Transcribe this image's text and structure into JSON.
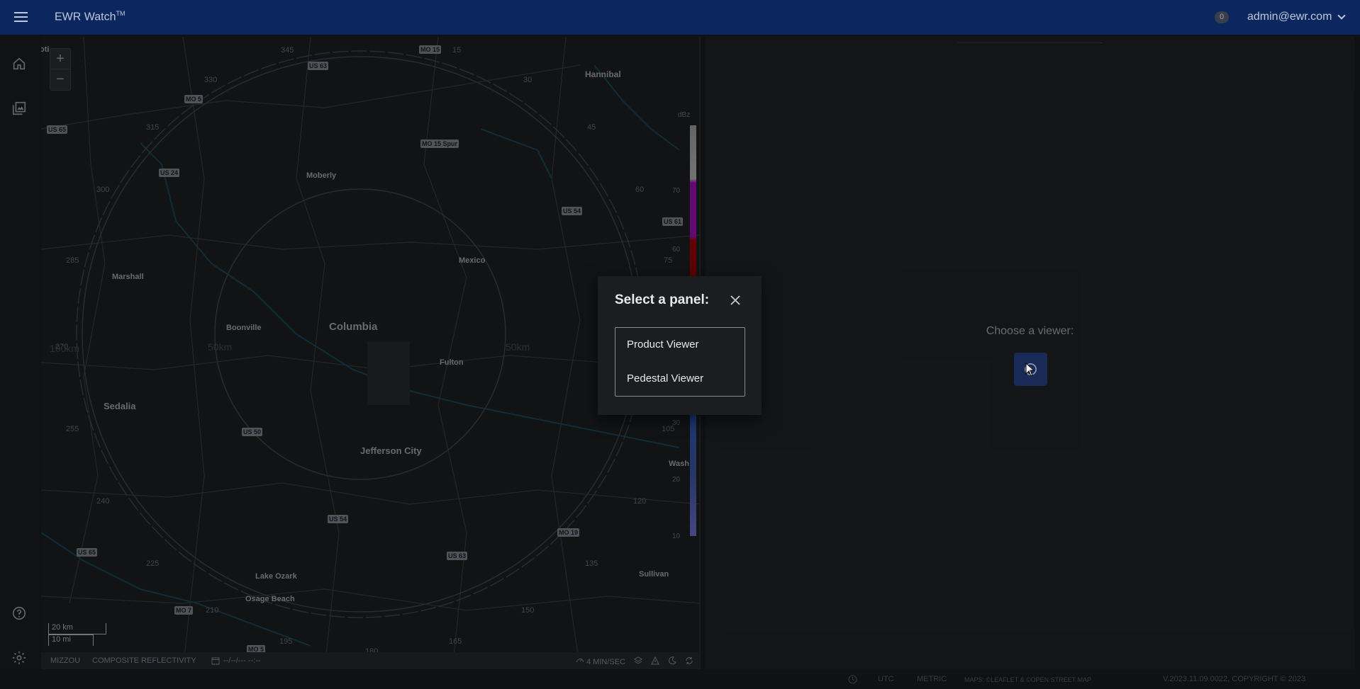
{
  "header": {
    "app_title": "EWR Watch",
    "app_title_mark": "TM",
    "notification_count": "0",
    "user": "admin@ewr.com"
  },
  "leftnav": {
    "icons": [
      "home-icon",
      "gallery-icon",
      "help-icon",
      "settings-icon"
    ]
  },
  "map": {
    "zoom_in": "+",
    "zoom_out": "−",
    "cities": {
      "hannibal": "Hannibal",
      "moberly": "Moberly",
      "marshall": "Marshall",
      "mexico": "Mexico",
      "boonville": "Boonville",
      "columbia": "Columbia",
      "fulton": "Fulton",
      "sedalia": "Sedalia",
      "jefferson_city": "Jefferson City",
      "lake_ozark": "Lake Ozark",
      "osage_beach": "Osage Beach",
      "sullivan": "Sullivan",
      "wash": "Wash",
      "partial": "oti"
    },
    "shields": {
      "us63_top": "US 63",
      "mo15_top": "MO 15",
      "mo5_top": "MO 5",
      "us65_top": "US 65",
      "mo15spur": "MO 15 Spur",
      "us24": "US 24",
      "us54_top": "US 54",
      "us61": "US 61",
      "us50": "US 50",
      "us54_bottom": "US 54",
      "mo19": "MO 19",
      "us63_bottom": "US 63",
      "us65_bottom": "US 65",
      "mo7": "MO 7",
      "mo5_bottom": "MO 5"
    },
    "ring_labels": {
      "r345": "345",
      "r15": "15",
      "r30": "30",
      "r45": "45",
      "r60": "60",
      "r75": "75",
      "r330": "330",
      "r315": "315",
      "r300": "300",
      "r285": "285",
      "r270": "270",
      "r255": "255",
      "r240": "240",
      "r225": "225",
      "r210": "210",
      "r195": "195",
      "r180": "180",
      "r165": "165",
      "r150": "150",
      "r135": "135",
      "r120": "120",
      "r105": "105"
    },
    "range_labels": {
      "left_100": "100km",
      "left_50": "50km",
      "right_50": "50km"
    },
    "legend": {
      "unit": "dBz",
      "ticks": [
        "70",
        "60",
        "30",
        "20",
        "10"
      ]
    },
    "scale": {
      "km": "20 km",
      "mi": "10 mi"
    },
    "footer": {
      "site": "MIZZOU",
      "product": "COMPOSITE REFLECTIVITY",
      "datetime": "--/--/--- --:--",
      "speed": "4 MIN/SEC"
    }
  },
  "right_panel": {
    "prompt": "Choose a viewer:"
  },
  "status_bar": {
    "tz": "UTC",
    "units": "METRIC",
    "maps": "MAPS: ©LEAFLET & ©OPEN STREET MAP",
    "version": "V.2023.11.09.0022, COPYRIGHT © 2023"
  },
  "dialog": {
    "title": "Select a panel:",
    "options": [
      "Product Viewer",
      "Pedestal Viewer"
    ]
  }
}
